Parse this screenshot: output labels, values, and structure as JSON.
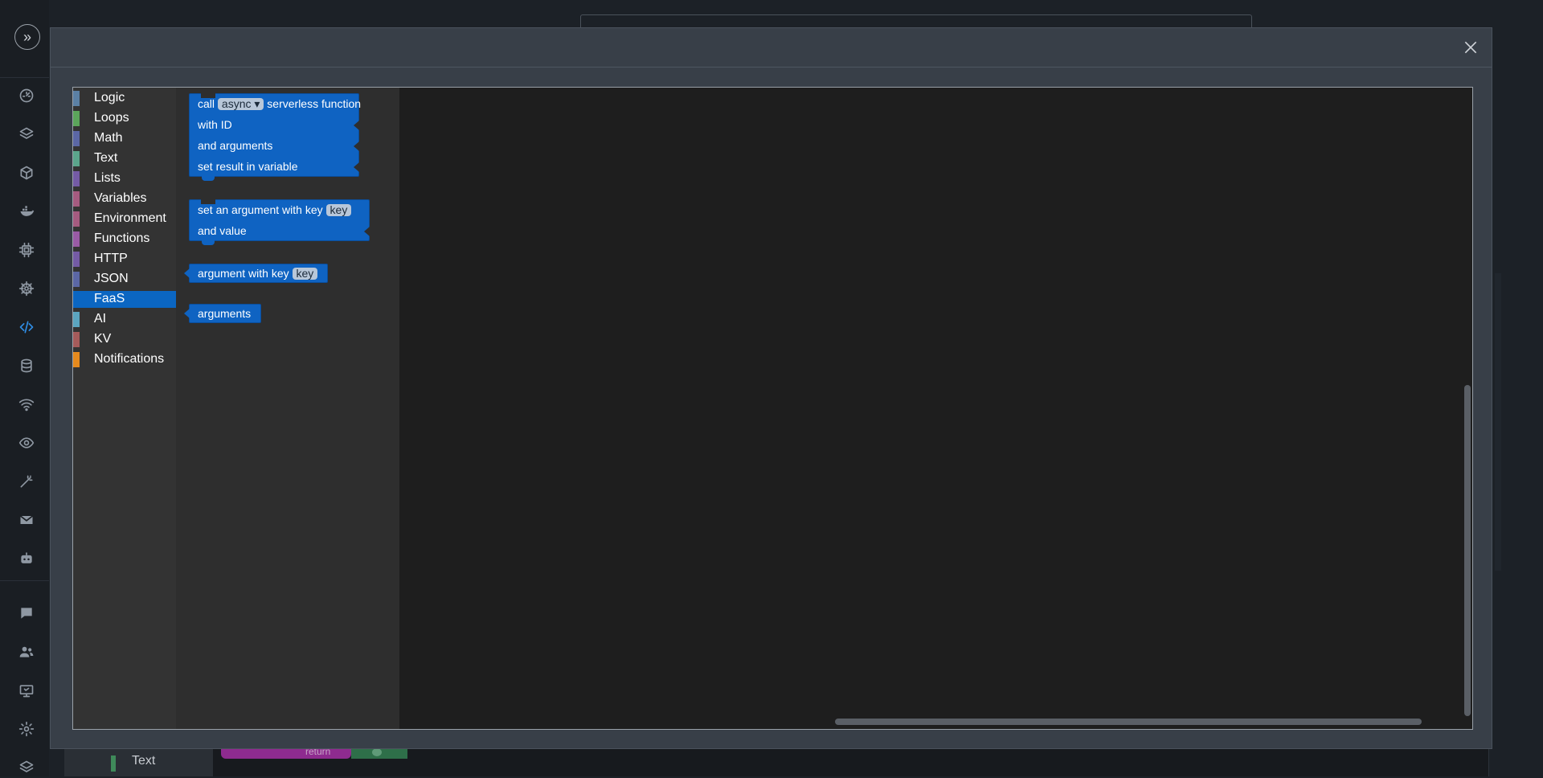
{
  "app": {
    "expand_glyph": "»",
    "sidebar_icons": [
      "dashboard-icon",
      "layers-icon",
      "cube-icon",
      "docker-icon",
      "chip-icon",
      "helm-icon",
      "code-icon",
      "database-icon",
      "wifi-icon",
      "eye-icon",
      "magic-wand-icon",
      "mail-icon",
      "robot-icon",
      "chat-icon",
      "users-icon",
      "screen-icon",
      "settings-icon",
      "stack-icon"
    ],
    "active_icon": "code-icon",
    "accent_color": "#2f8de4"
  },
  "background": {
    "text_item_label": "Text",
    "block_label": "return"
  },
  "modal": {
    "close_icon": "close-icon"
  },
  "toolbox": {
    "selected": "FaaS",
    "categories": [
      {
        "label": "Logic",
        "color": "#5b80a5"
      },
      {
        "label": "Loops",
        "color": "#5ba55b"
      },
      {
        "label": "Math",
        "color": "#5b67a5"
      },
      {
        "label": "Text",
        "color": "#5ba58c"
      },
      {
        "label": "Lists",
        "color": "#745ba5"
      },
      {
        "label": "Variables",
        "color": "#a55b80"
      },
      {
        "label": "Environment",
        "color": "#a55b80"
      },
      {
        "label": "Functions",
        "color": "#995ba5"
      },
      {
        "label": "HTTP",
        "color": "#745ba5"
      },
      {
        "label": "JSON",
        "color": "#5b67a5"
      },
      {
        "label": "FaaS",
        "color": "#0b66c2"
      },
      {
        "label": "AI",
        "color": "#5ba5c0"
      },
      {
        "label": "KV",
        "color": "#a55b5b"
      },
      {
        "label": "Notifications",
        "color": "#e58a1e"
      }
    ]
  },
  "flyout": {
    "block_color": "#0f63c2",
    "call_block": {
      "call": "call",
      "mode": "async",
      "mode_arrow": "▾",
      "rest": "serverless function",
      "with_id": "with ID",
      "and_arguments": "and arguments",
      "set_result": "set result in variable"
    },
    "set_arg_block": {
      "label": "set an argument with key",
      "key": "key",
      "and_value": "and value"
    },
    "arg_block": {
      "label": "argument with key",
      "key": "key"
    },
    "arguments_block": {
      "label": "arguments"
    }
  }
}
